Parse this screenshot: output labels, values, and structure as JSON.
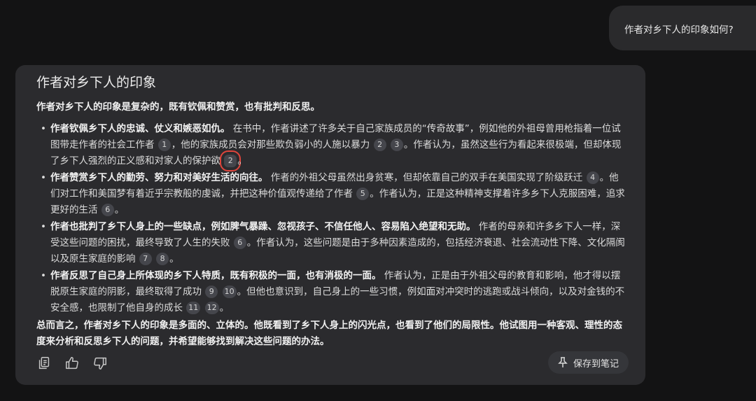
{
  "user_message": "作者对乡下人的印象如何?",
  "response": {
    "title": "作者对乡下人的印象",
    "intro": "作者对乡下人的印象是复杂的，既有钦佩和赞赏，也有批判和反思。",
    "bullets": [
      {
        "lead": "作者钦佩乡下人的忠诚、仗义和嫉恶如仇。",
        "t1": "在书中，作者讲述了许多关于自己家族成员的“传奇故事”，例如他的外祖母曾用枪指着一位试图带走作者的社会工作者",
        "t2": "，他的家族成员会对那些欺负弱小的人施以暴力",
        "t3": "。作者认为，虽然这些行为看起来很极端，但却体现了乡下人强烈的正义感和对家人的保护欲",
        "t4": "。",
        "c": [
          "1",
          "2",
          "3",
          "2"
        ]
      },
      {
        "lead": "作者赞赏乡下人的勤劳、努力和对美好生活的向往。",
        "t1": "作者的外祖父母虽然出身贫寒，但却依靠自己的双手在美国实现了阶级跃迁",
        "t2": "。他们对工作和美国梦有着近乎宗教般的虔诚，并把这种价值观传递给了作者",
        "t3": "。作者认为，正是这种精神支撑着许多乡下人克服困难，追求更好的生活",
        "t4": "。",
        "c": [
          "4",
          "5",
          "6"
        ]
      },
      {
        "lead": "作者也批判了乡下人身上的一些缺点，例如脾气暴躁、忽视孩子、不信任他人、容易陷入绝望和无助。",
        "t1": "作者的母亲和许多乡下人一样，深受这些问题的困扰，最终导致了人生的失败",
        "t2": "。作者认为，这些问题是由于多种因素造成的，包括经济衰退、社会流动性下降、文化隔阂以及原生家庭的影响",
        "t4": "。",
        "c": [
          "6",
          "7",
          "8"
        ]
      },
      {
        "lead": "作者反思了自己身上所体现的乡下人特质，既有积极的一面，也有消极的一面。",
        "t1": "作者认为，正是由于外祖父母的教育和影响，他才得以摆脱原生家庭的阴影，最终取得了成功",
        "t2": "。但他也意识到，自己身上的一些习惯，例如面对冲突时的逃跑或战斗倾向，以及对金钱的不安全感，也限制了他自身的成长",
        "t4": "。",
        "c": [
          "9",
          "10",
          "11",
          "12"
        ]
      }
    ],
    "summary": "总而言之，作者对乡下人的印象是多面的、立体的。他既看到了乡下人身上的闪光点，也看到了他们的局限性。他试图用一种客观、理性的态度来分析和反思乡下人的问题，并希望能够找到解决这些问题的办法。"
  },
  "actions": {
    "icons": [
      "copy-icon",
      "thumbs-up-icon",
      "thumbs-down-icon"
    ],
    "save_label": "保存到笔记",
    "save_icon": "pin-icon"
  },
  "colors": {
    "background": "#131314",
    "card": "#2b2b2e",
    "citation_chip": "#45464c",
    "highlight": "#e0453c"
  }
}
